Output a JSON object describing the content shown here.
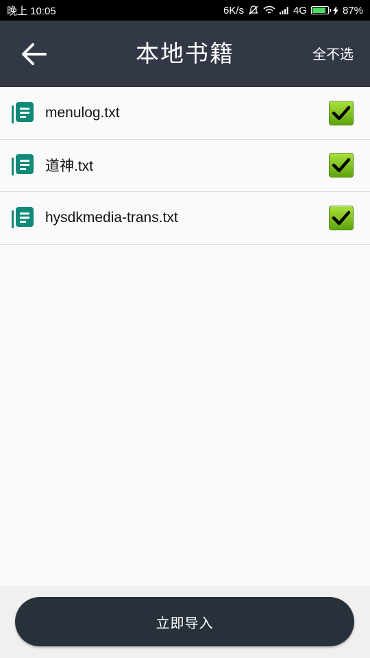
{
  "status_bar": {
    "time": "晚上 10:05",
    "network_speed": "6K/s",
    "network_type": "4G",
    "battery": "87%",
    "battery_level": 0.87
  },
  "header": {
    "title": "本地书籍",
    "deselect_all_label": "全不选"
  },
  "files": [
    {
      "name": "menulog.txt",
      "checked": true
    },
    {
      "name": "道神.txt",
      "checked": true
    },
    {
      "name": "hysdkmedia-trans.txt",
      "checked": true
    }
  ],
  "footer": {
    "import_label": "立即导入"
  },
  "colors": {
    "app_bar": "#333847",
    "icon_teal": "#0f8a78",
    "checkbox_green": "#7cc41f",
    "button_dark": "#283139"
  }
}
